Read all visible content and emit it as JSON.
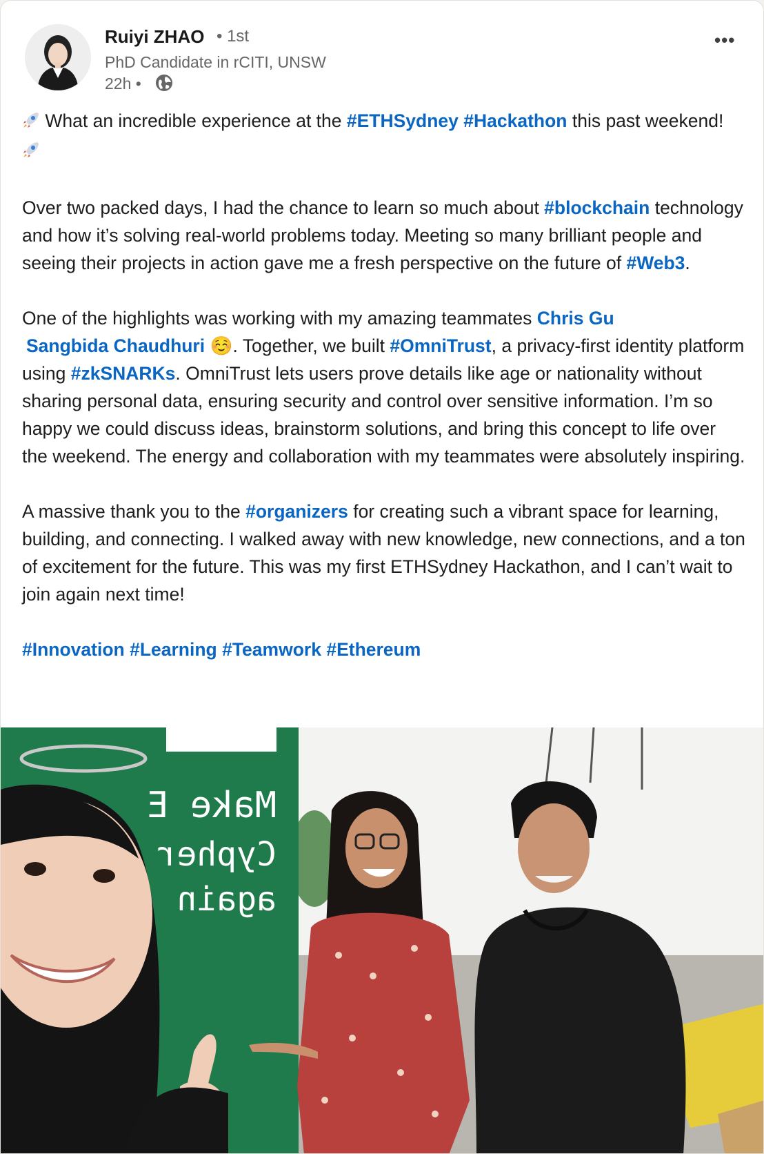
{
  "author": {
    "name": "Ruiyi ZHAO",
    "degree": "• 1st",
    "headline": "PhD Candidate in rCITI, UNSW",
    "time": "22h •"
  },
  "header_icons": {
    "visibility": "globe-icon",
    "more": "•••"
  },
  "post": {
    "p1_a": " What an incredible experience at the ",
    "p1_tag1": "#ETHSydney",
    "p1_sp": " ",
    "p1_tag2": "#Hackathon",
    "p1_b": " this past weekend! ",
    "p2_a": "Over two packed days, I had the chance to learn so much about ",
    "p2_tag1": "#blockchain",
    "p2_b": " technology and how it’s solving real-world problems today. Meeting so many brilliant people and seeing their projects in action gave me a fresh perspective on the future of ",
    "p2_tag2": "#Web3",
    "p2_c": ".",
    "p3_a": "One of the highlights was working with my amazing teammates ",
    "p3_mention1": "Chris Gu",
    "p3_mention2": "Sangbida Chaudhuri",
    "p3_emoji": "☺️",
    "p3_b": ". Together, we built ",
    "p3_tag1": "#OmniTrust",
    "p3_c": ", a privacy-first identity platform using ",
    "p3_tag2": "#zkSNARKs",
    "p3_d": ". OmniTrust lets users prove details like age or nationality without sharing personal data, ensuring security and control over sensitive information. I’m so happy we could discuss ideas, brainstorm solutions, and bring this concept to life over the weekend. The energy and collaboration with my teammates were absolutely inspiring.",
    "p4_a": "A massive thank you to the ",
    "p4_tag1": "#organizers",
    "p4_b": " for creating such a vibrant space for learning, building, and connecting. I walked away with new knowledge, new connections, and a ton of excitement for the future. This was my first ETHSydney Hackathon, and I can’t wait to join again next time!",
    "hashtags": [
      "#Innovation",
      "#Learning",
      "#Teamwork",
      "#Ethereum"
    ]
  },
  "photo": {
    "banner_lines": [
      "Make E",
      "Cypher",
      "again"
    ],
    "banner_color": "#1f7a4c"
  },
  "colors": {
    "link": "#0a66c2",
    "text": "#1d1d1d",
    "secondary": "#666666"
  }
}
